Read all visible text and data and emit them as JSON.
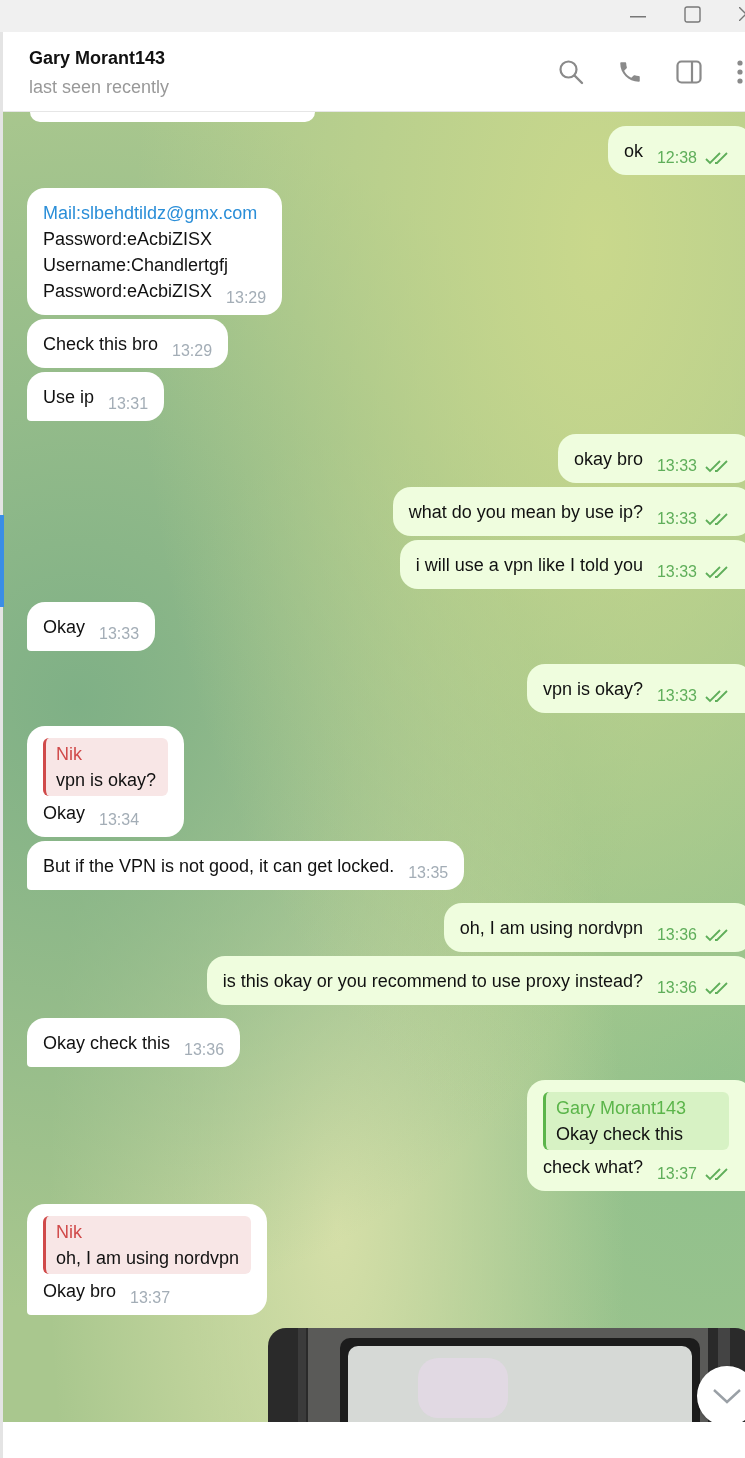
{
  "header": {
    "title": "Gary Morant143",
    "status": "last seen recently"
  },
  "messages": [
    {
      "kind": "text",
      "outgoing": true,
      "text": "ok",
      "time": "12:38",
      "read": true,
      "tail": true
    },
    {
      "kind": "lines",
      "outgoing": false,
      "lines": [
        {
          "text": "Mail:slbehdtildz@gmx.com",
          "link": true
        },
        {
          "text": "Password:eAcbiZISX",
          "link": false
        },
        {
          "text": "Username:Chandlertgfj",
          "link": false
        },
        {
          "text": "Password:eAcbiZISX",
          "link": false
        }
      ],
      "time": "13:29",
      "tail": false
    },
    {
      "kind": "text",
      "outgoing": false,
      "text": "Check this bro",
      "time": "13:29",
      "tail": false
    },
    {
      "kind": "text",
      "outgoing": false,
      "text": "Use ip",
      "time": "13:31",
      "tail": true
    },
    {
      "kind": "text",
      "outgoing": true,
      "text": "okay bro",
      "time": "13:33",
      "read": true,
      "tail": false
    },
    {
      "kind": "text",
      "outgoing": true,
      "text": "what do you mean by use ip?",
      "time": "13:33",
      "read": true,
      "tail": false
    },
    {
      "kind": "text",
      "outgoing": true,
      "text": "i will use a vpn like I told you",
      "time": "13:33",
      "read": true,
      "tail": true
    },
    {
      "kind": "text",
      "outgoing": false,
      "text": "Okay",
      "time": "13:33",
      "tail": true
    },
    {
      "kind": "text",
      "outgoing": true,
      "text": "vpn is okay?",
      "time": "13:33",
      "read": true,
      "tail": true
    },
    {
      "kind": "reply",
      "outgoing": false,
      "reply": {
        "author": "Nik",
        "text": "vpn is okay?",
        "color": "#d04a4a"
      },
      "text": "Okay",
      "time": "13:34",
      "tail": false
    },
    {
      "kind": "text",
      "outgoing": false,
      "text": "But if the VPN is not good, it can get locked.",
      "time": "13:35",
      "tail": true
    },
    {
      "kind": "text",
      "outgoing": true,
      "text": "oh, I am using nordvpn",
      "time": "13:36",
      "read": true,
      "tail": false
    },
    {
      "kind": "text",
      "outgoing": true,
      "text": "is this okay or you recommend to use proxy instead?",
      "time": "13:36",
      "read": true,
      "tail": true
    },
    {
      "kind": "text",
      "outgoing": false,
      "text": "Okay check this",
      "time": "13:36",
      "tail": true
    },
    {
      "kind": "reply",
      "outgoing": true,
      "reply": {
        "author": "Gary Morant143",
        "text": "Okay check this",
        "color": "#5bb54a"
      },
      "text": "check what?",
      "time": "13:37",
      "read": true,
      "tail": true
    },
    {
      "kind": "reply",
      "outgoing": false,
      "reply": {
        "author": "Nik",
        "text": "oh, I am using nordvpn",
        "color": "#d04a4a"
      },
      "text": "Okay bro",
      "time": "13:37",
      "tail": true
    },
    {
      "kind": "picture",
      "outgoing": true
    }
  ]
}
